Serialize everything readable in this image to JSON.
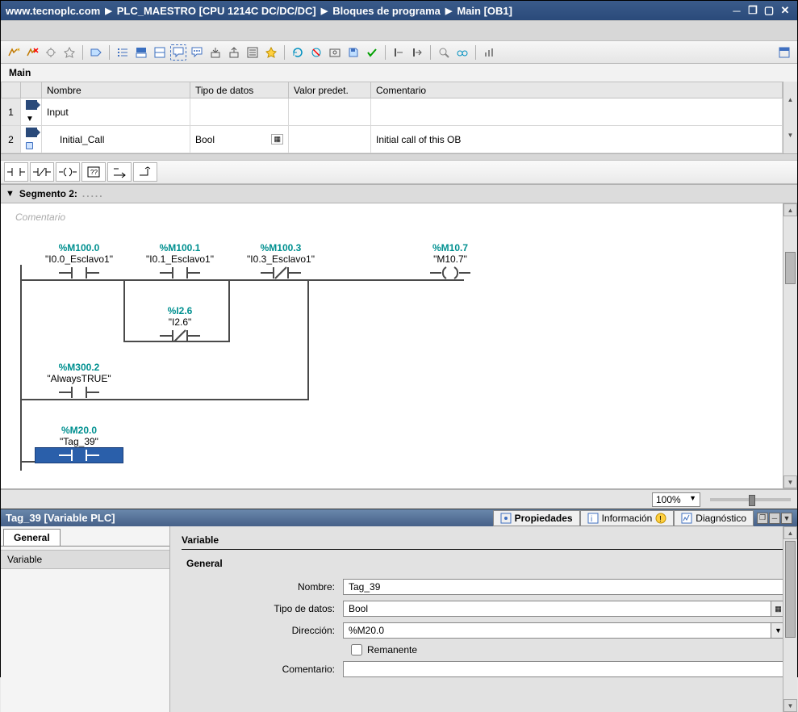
{
  "titlebar": {
    "crumb1": "www.tecnoplc.com",
    "crumb2": "PLC_MAESTRO [CPU 1214C DC/DC/DC]",
    "crumb3": "Bloques de programa",
    "crumb4": "Main [OB1]"
  },
  "main_header": "Main",
  "iface": {
    "headers": {
      "name": "Nombre",
      "datatype": "Tipo de datos",
      "preset": "Valor predet.",
      "comment": "Comentario"
    },
    "rows": [
      {
        "num": "1",
        "name": "Input",
        "datatype": "",
        "preset": "",
        "comment": ""
      },
      {
        "num": "2",
        "name": "Initial_Call",
        "datatype": "Bool",
        "preset": "",
        "comment": "Initial call of this OB"
      }
    ]
  },
  "segment": {
    "title": "Segmento 2:",
    "comment_hint": "Comentario"
  },
  "rung": {
    "c1": {
      "addr": "%M100.0",
      "name": "\"I0.0_Esclavo1\""
    },
    "c2": {
      "addr": "%M100.1",
      "name": "\"I0.1_Esclavo1\""
    },
    "c3": {
      "addr": "%M100.3",
      "name": "\"I0.3_Esclavo1\""
    },
    "coil1": {
      "addr": "%M10.7",
      "name": "\"M10.7\""
    },
    "c4": {
      "addr": "%I2.6",
      "name": "\"I2.6\""
    },
    "c5": {
      "addr": "%M300.2",
      "name": "\"AlwaysTRUE\""
    },
    "c6": {
      "addr": "%M20.0",
      "name": "\"Tag_39\""
    }
  },
  "zoom": "100%",
  "props": {
    "title": "Tag_39 [Variable PLC]",
    "tabs": {
      "prop": "Propiedades",
      "info": "Información",
      "diag": "Diagnóstico"
    },
    "left_tab": "General",
    "left_item": "Variable",
    "section": "Variable",
    "group": "General",
    "labels": {
      "nombre": "Nombre:",
      "tipo": "Tipo de datos:",
      "dir": "Dirección:",
      "rem": "Remanente",
      "comm": "Comentario:"
    },
    "values": {
      "nombre": "Tag_39",
      "tipo": "Bool",
      "dir": "%M20.0",
      "comm": ""
    }
  }
}
